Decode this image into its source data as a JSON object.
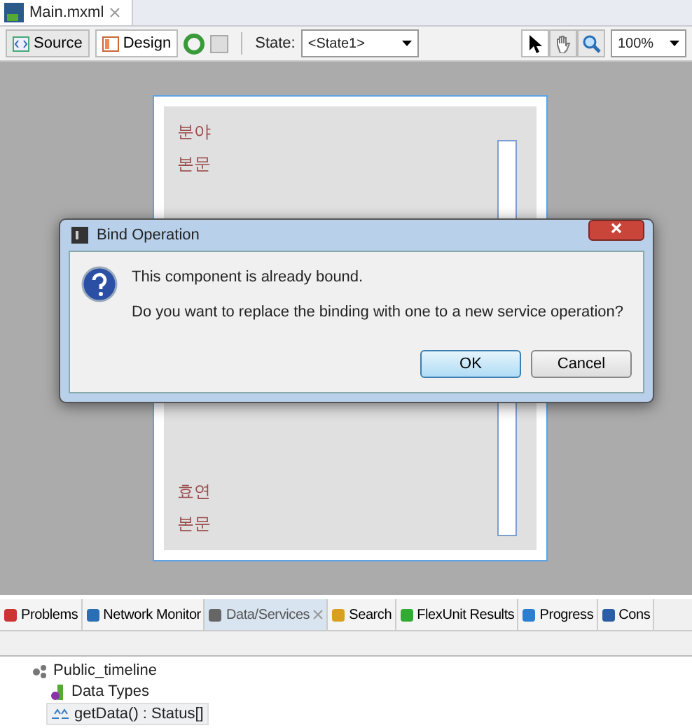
{
  "editor_tab": {
    "title": "Main.mxml"
  },
  "toolbar": {
    "view_buttons": [
      {
        "label": "Source",
        "selected": false
      },
      {
        "label": "Design",
        "selected": true
      }
    ],
    "state_label": "State:",
    "state_value": "<State1>",
    "tools": [
      {
        "kind": "pointer",
        "selected": true
      },
      {
        "kind": "hand",
        "selected": false
      },
      {
        "kind": "zoom",
        "selected": false
      }
    ],
    "zoom_value": "100%"
  },
  "canvas": {
    "top_items": [
      "분야",
      "본문"
    ],
    "bottom_items": [
      "효연",
      "본문"
    ]
  },
  "dialog": {
    "title": "Bind Operation",
    "messages": [
      "This component is already bound.",
      "Do you want to replace the binding with one to a new service operation?"
    ],
    "buttons": [
      {
        "label": "OK",
        "default": true
      },
      {
        "label": "Cancel",
        "default": false
      }
    ]
  },
  "panel_tabs": [
    {
      "label": "Problems",
      "selected": false
    },
    {
      "label": "Network Monitor",
      "selected": false
    },
    {
      "label": "Data/Services",
      "selected": true
    },
    {
      "label": "Search",
      "selected": false
    },
    {
      "label": "FlexUnit Results",
      "selected": false
    },
    {
      "label": "Progress",
      "selected": false
    },
    {
      "label": "Cons",
      "selected": false
    }
  ],
  "tree": {
    "label": "Public_timeline",
    "children": [
      {
        "label": "Data Types",
        "selected": false
      },
      {
        "label": "getData() : Status[]",
        "selected": true
      }
    ]
  }
}
